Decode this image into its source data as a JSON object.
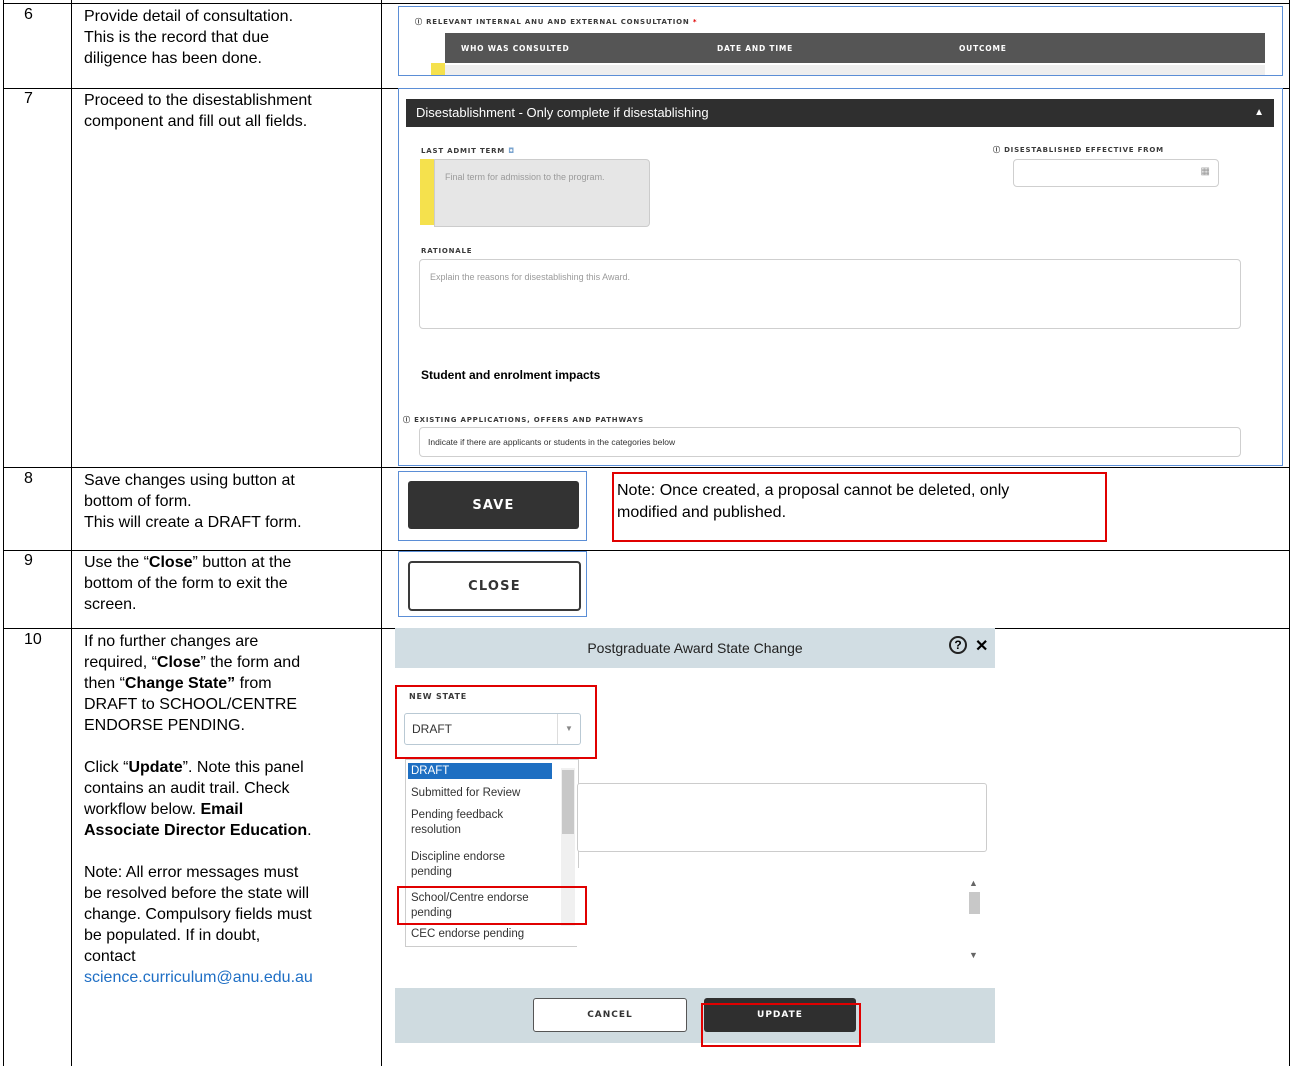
{
  "rows": [
    {
      "num": "6",
      "lines": [
        "Provide detail of consultation.",
        "This is the record that due",
        "diligence has been done."
      ]
    },
    {
      "num": "7",
      "lines": [
        "Proceed to the disestablishment",
        "component and fill out all fields."
      ]
    },
    {
      "num": "8",
      "lines": [
        "Save changes using button at",
        "bottom of form.",
        "This will create a DRAFT form."
      ]
    },
    {
      "num": "9",
      "pre": "Use the “",
      "bold": "Close",
      "post": "” button at the",
      "lines": [
        "bottom of the form to exit the",
        "screen."
      ]
    },
    {
      "num": "10"
    }
  ],
  "row10": {
    "l1": "If no further changes are",
    "l2a": "required, “",
    "l2b": "Close",
    "l2c": "” the form and",
    "l3a": "then “",
    "l3b": "Change State”",
    "l3c": " from",
    "l4": "DRAFT to SCHOOL/CENTRE",
    "l5": "ENDORSE PENDING.",
    "l6a": "Click “",
    "l6b": "Update",
    "l6c": "”. Note this panel",
    "l7": "contains an audit trail. Check",
    "l8a": "workflow below. ",
    "l8b": "Email",
    "l9": "Associate Director Education",
    "l9c": ".",
    "n1": "Note: All error messages must",
    "n2": "be resolved before the state will",
    "n3": "change. Compulsory fields must",
    "n4": "be populated. If in doubt,",
    "n5": "contact",
    "email": "science.curriculum@anu.edu.au"
  },
  "consultation": {
    "label": "RELEVANT INTERNAL ANU AND EXTERNAL CONSULTATION",
    "required": "*",
    "cols": [
      "WHO WAS CONSULTED",
      "DATE AND TIME",
      "OUTCOME"
    ]
  },
  "disestablishment": {
    "title": "Disestablishment - Only complete if disestablishing",
    "last_admit_label": "LAST ADMIT TERM",
    "last_admit_placeholder": "Final term for admission to the program.",
    "effective_label": "DISESTABLISHED EFFECTIVE FROM",
    "rationale_label": "RATIONALE",
    "rationale_placeholder": "Explain the reasons for disestablishing this Award.",
    "impacts_heading": "Student and enrolment impacts",
    "existing_label": "EXISTING APPLICATIONS, OFFERS AND PATHWAYS",
    "existing_text": "Indicate if there are applicants or students in the categories below"
  },
  "save_label": "SAVE",
  "close_label": "CLOSE",
  "note": [
    "Note: Once created, a proposal cannot be deleted, only",
    "modified and published."
  ],
  "dialog": {
    "title": "Postgraduate Award State Change",
    "help": "?",
    "close": "✕",
    "new_state_label": "NEW STATE",
    "selected": "DRAFT",
    "options": [
      "DRAFT",
      "Submitted for Review",
      "Pending feedback",
      "resolution",
      "Discipline endorse",
      "pending",
      "School/Centre endorse",
      "pending",
      "CEC endorse pending"
    ],
    "cancel": "CANCEL",
    "update": "UPDATE"
  }
}
